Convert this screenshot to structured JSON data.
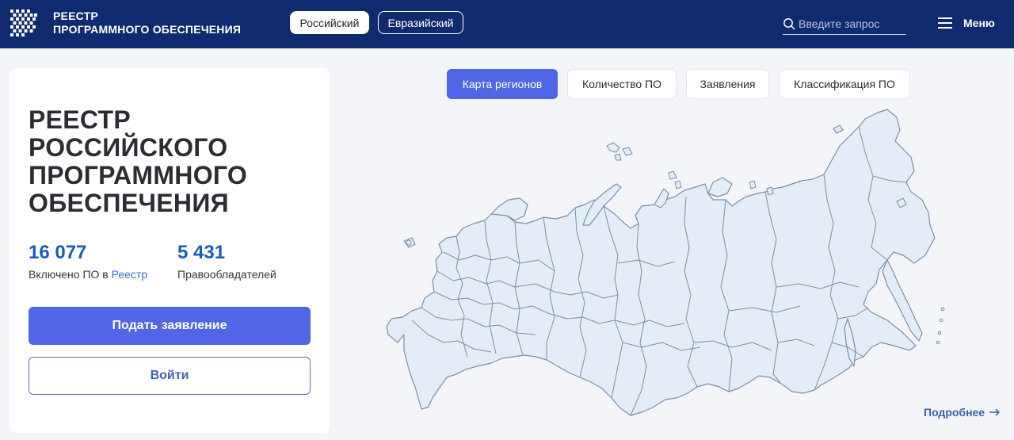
{
  "header": {
    "logo_line1": "РЕЕСТР",
    "logo_line2": "ПРОГРАММНОГО ОБЕСПЕЧЕНИЯ",
    "tabs": [
      {
        "label": "Российский",
        "active": true
      },
      {
        "label": "Евразийский",
        "active": false
      }
    ],
    "search": {
      "placeholder": "Введите запрос",
      "icon": "search-icon"
    },
    "menu_label": "Меню"
  },
  "card": {
    "title_lines": [
      "РЕЕСТР",
      "РОССИЙСКОГО",
      "ПРОГРАММНОГО",
      "ОБЕСПЕЧЕНИЯ"
    ],
    "stats": [
      {
        "value": "16 077",
        "label_prefix": "Включено ПО в ",
        "label_link": "Реестр"
      },
      {
        "value": "5 431",
        "label": "Правообладателей"
      }
    ],
    "primary_button": "Подать заявление",
    "secondary_button": "Войти"
  },
  "map_tabs": [
    {
      "label": "Карта регионов",
      "active": true
    },
    {
      "label": "Количество ПО",
      "active": false
    },
    {
      "label": "Заявления",
      "active": false
    },
    {
      "label": "Классификация ПО",
      "active": false
    }
  ],
  "more_link": "Подробнее",
  "colors": {
    "header_bg": "#0f2a6e",
    "accent": "#5066e6",
    "stat_blue": "#1e5bb8",
    "map_fill": "#e4ecf8",
    "map_stroke": "#7b8fa8"
  }
}
